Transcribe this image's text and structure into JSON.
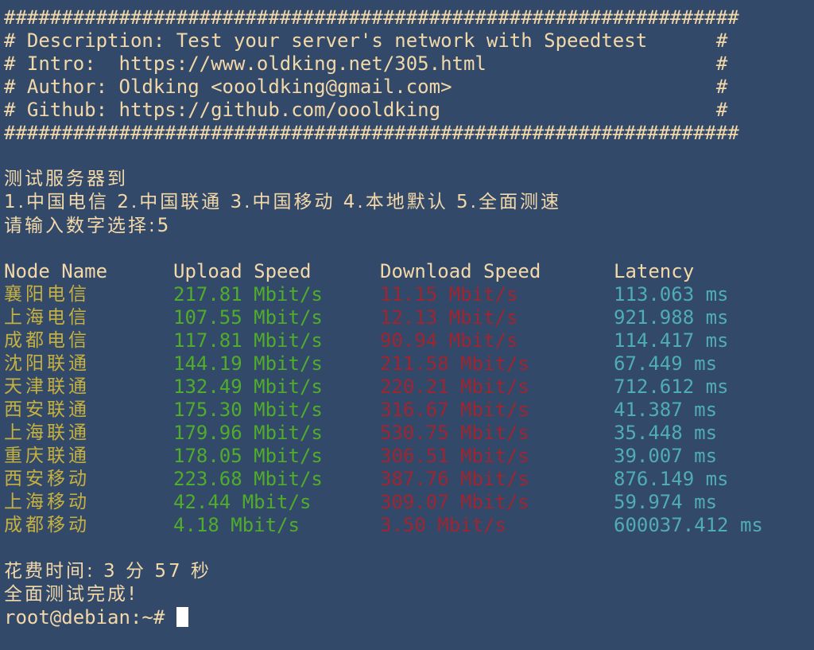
{
  "terminal": {
    "background_color": "#33496a",
    "colors": {
      "cream": "#f3d8a8",
      "yellow": "#c6b13e",
      "green": "#4fad2a",
      "red": "#9f2530",
      "teal": "#4fadb3",
      "cursor": "#ffffff"
    }
  },
  "banner": {
    "rule_top": "################################################################",
    "lines": [
      "# Description: Test your server's network with Speedtest      #",
      "# Intro:  https://www.oldking.net/305.html                    #",
      "# Author: Oldking <oooldking@gmail.com>                       #",
      "# Github: https://github.com/oooldking                        #"
    ],
    "rule_bottom": "################################################################"
  },
  "menu": {
    "prompt_title": "测试服务器到",
    "options_line": "1.中国电信 2.中国联通 3.中国移动 4.本地默认 5.全面测速",
    "options": [
      {
        "number": "1",
        "label": "中国电信"
      },
      {
        "number": "2",
        "label": "中国联通"
      },
      {
        "number": "3",
        "label": "中国移动"
      },
      {
        "number": "4",
        "label": "本地默认"
      },
      {
        "number": "5",
        "label": "全面测速"
      }
    ],
    "input_label": "请输入数字选择:",
    "input_value": "5"
  },
  "table": {
    "headers": {
      "node": "Node Name",
      "upload": "Upload Speed",
      "download": "Download Speed",
      "latency": "Latency"
    },
    "rows": [
      {
        "node": "襄阳电信",
        "upload": "217.81 Mbit/s",
        "download": "11.15 Mbit/s",
        "latency": "113.063 ms"
      },
      {
        "node": "上海电信",
        "upload": "107.55 Mbit/s",
        "download": "12.13 Mbit/s",
        "latency": "921.988 ms"
      },
      {
        "node": "成都电信",
        "upload": "117.81 Mbit/s",
        "download": "90.94 Mbit/s",
        "latency": "114.417 ms"
      },
      {
        "node": "沈阳联通",
        "upload": "144.19 Mbit/s",
        "download": "211.58 Mbit/s",
        "latency": "67.449 ms"
      },
      {
        "node": "天津联通",
        "upload": "132.49 Mbit/s",
        "download": "220.21 Mbit/s",
        "latency": "712.612 ms"
      },
      {
        "node": "西安联通",
        "upload": "175.30 Mbit/s",
        "download": "316.67 Mbit/s",
        "latency": "41.387 ms"
      },
      {
        "node": "上海联通",
        "upload": "179.96 Mbit/s",
        "download": "530.75 Mbit/s",
        "latency": "35.448 ms"
      },
      {
        "node": "重庆联通",
        "upload": "178.05 Mbit/s",
        "download": "306.51 Mbit/s",
        "latency": "39.007 ms"
      },
      {
        "node": "西安移动",
        "upload": "223.68 Mbit/s",
        "download": "387.76 Mbit/s",
        "latency": "876.149 ms"
      },
      {
        "node": "上海移动",
        "upload": "42.44 Mbit/s",
        "download": "309.07 Mbit/s",
        "latency": "59.974 ms"
      },
      {
        "node": "成都移动",
        "upload": "4.18 Mbit/s",
        "download": "3.50 Mbit/s",
        "latency": "600037.412 ms"
      }
    ]
  },
  "footer": {
    "elapsed_line": "花费时间: 3 分 57 秒",
    "elapsed_minutes": "3",
    "elapsed_seconds": "57",
    "done_line": "全面测试完成!",
    "prompt": "root@debian:~# "
  }
}
